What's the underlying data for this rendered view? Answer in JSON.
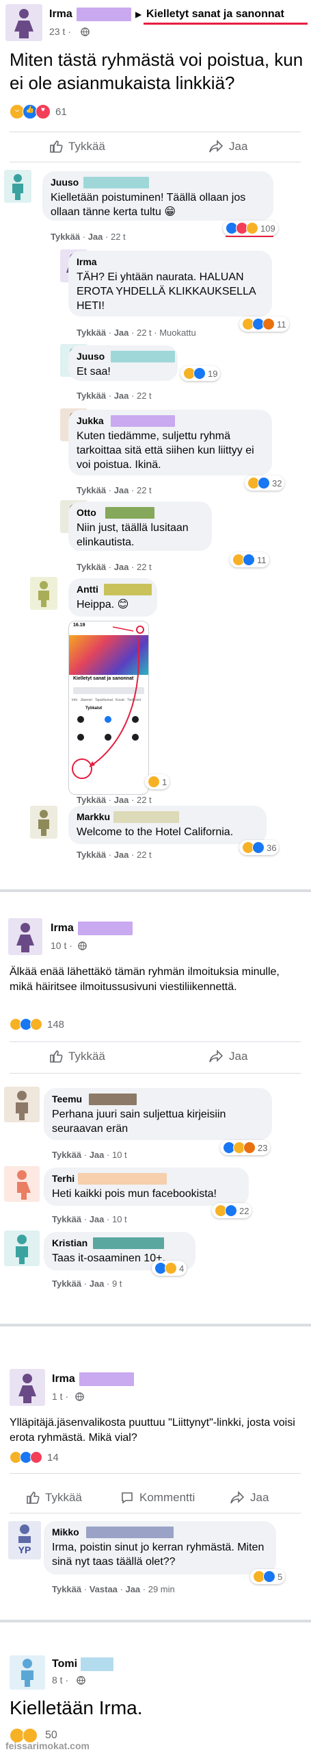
{
  "colors": {
    "blue_like": "#1877f2",
    "meta_gray": "#65676b",
    "bubble_bg": "#f0f2f5",
    "accent_red": "#e41e3f",
    "redaction_purple": "#c9a9ef",
    "redaction_teal": "#9fd7d9",
    "redaction_green": "#86a85a",
    "redaction_yellow": "#c9c25a",
    "redaction_sand": "#dcdab8",
    "redaction_brown": "#8c7968",
    "redaction_peach": "#f6cfad",
    "redaction_slate": "#9aa3c6",
    "redaction_lightblue": "#b4dcef"
  },
  "header": {
    "group_name": "Kielletyt sanat ja sanonnat",
    "separator_glyph": "▶"
  },
  "post1": {
    "author": "Irma",
    "time": "23 t ·",
    "text": "Miten tästä ryhmästä voi poistua, kun ei ole asianmukaista linkkiä?",
    "reactions_count": "61",
    "like_label": "Tykkää",
    "share_label": "Jaa"
  },
  "comments1": [
    {
      "author": "Juuso",
      "text": "Kielletään poistuminen! Täällä ollaan jos ollaan tänne kerta tultu 😁",
      "like": "Tykkää",
      "reply": "Jaa",
      "time": "22 t",
      "count": "109"
    },
    {
      "author": "Irma",
      "text": "TÄH? Ei yhtään naurata. HALUAN EROTA YHDELLÄ KLIKKAUKSELLA HETI!",
      "like": "Tykkää",
      "reply": "Jaa",
      "time": "22 t",
      "edited": "Muokattu",
      "count": "11"
    },
    {
      "author": "Juuso",
      "text": "Et saa!",
      "like": "Tykkää",
      "reply": "Jaa",
      "time": "22 t",
      "count": "19"
    },
    {
      "author": "Jukka",
      "text": "Kuten tiedämme, suljettu ryhmä tarkoittaa sitä että siihen kun liittyy ei voi poistua. Ikinä.",
      "like": "Tykkää",
      "reply": "Jaa",
      "time": "22 t",
      "count": "32"
    },
    {
      "author": "Otto",
      "text": "Niin just, täällä lusitaan elinkautista.",
      "like": "Tykkää",
      "reply": "Jaa",
      "time": "22 t",
      "count": "11"
    },
    {
      "author": "Antti",
      "text": "Heippa. 😊",
      "like": "Tykkää",
      "reply": "Jaa",
      "time": "22 t",
      "image_reaction_count": "1"
    },
    {
      "author": "Markku",
      "text": "Welcome to the Hotel California.",
      "like": "Tykkää",
      "reply": "Jaa",
      "time": "22 t",
      "count": "36"
    }
  ],
  "screenshot": {
    "status_time": "16.19",
    "group_title": "Kielletyt sanat ja sanonnat",
    "tabs": [
      "Info",
      "Jäsenet",
      "Tapahtumat",
      "Kuvat",
      "Tiedostot"
    ],
    "section": "Työkalut"
  },
  "post2": {
    "author": "Irma",
    "time": "10 t ·",
    "text": "Älkää enää lähettäkö tämän ryhmän ilmoituksia minulle, mikä häiritsee ilmoitussusivuni viestiliikennettä.",
    "reactions_count": "148",
    "like_label": "Tykkää",
    "share_label": "Jaa"
  },
  "comments2": [
    {
      "author": "Teemu",
      "text": "Perhana juuri sain suljettua kirjeisiin seuraavan erän",
      "like": "Tykkää",
      "reply": "Jaa",
      "time": "10 t",
      "count": "23"
    },
    {
      "author": "Terhi",
      "text": "Heti kaikki pois mun facebookista!",
      "like": "Tykkää",
      "reply": "Jaa",
      "time": "10 t",
      "count": "22"
    },
    {
      "author": "Kristian",
      "text": "Taas it-osaaminen 10+.",
      "like": "Tykkää",
      "reply": "Jaa",
      "time": "9 t",
      "count": "4"
    }
  ],
  "post3": {
    "author": "Irma",
    "time": "1 t ·",
    "text": "Ylläpitäjä.jäsenvalikosta puuttuu \"Liittynyt\"-linkki, josta voisi erota ryhmästä. Mikä vial?",
    "reactions_count": "14",
    "like_label": "Tykkää",
    "comment_label": "Kommentti",
    "share_label": "Jaa"
  },
  "comments3": [
    {
      "author": "Mikko",
      "avatar_initials": "YP",
      "text": "Irma, poistin sinut jo kerran ryhmästä. Miten sinä nyt taas täällä olet??",
      "like": "Tykkää",
      "reply_label": "Vastaa",
      "share": "Jaa",
      "time": "29 min",
      "count": "5"
    }
  ],
  "post4": {
    "author": "Tomi",
    "time": "8 t ·",
    "text": "Kielletään Irma.",
    "reactions_count": "50"
  },
  "watermark": "feissarimokat.com"
}
